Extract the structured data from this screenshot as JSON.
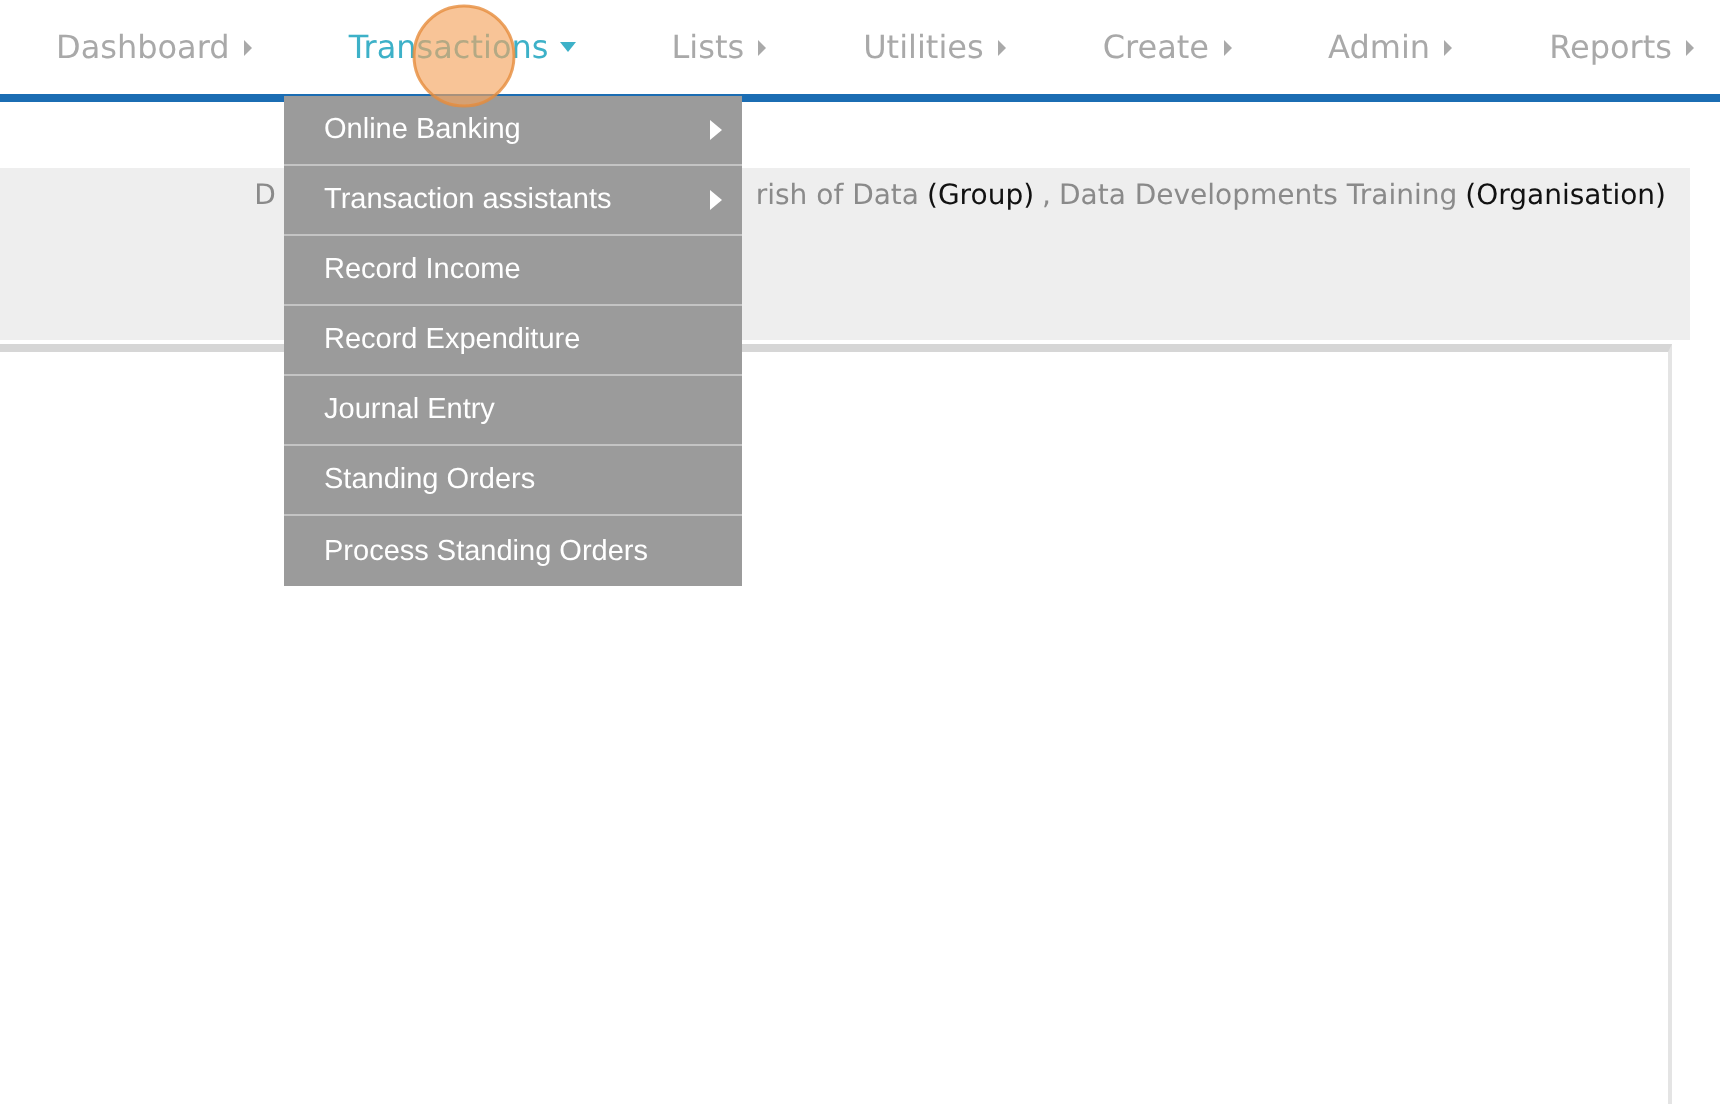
{
  "nav": [
    {
      "label": "Dashboard",
      "selected": false
    },
    {
      "label": "Transactions",
      "selected": true
    },
    {
      "label": "Lists",
      "selected": false
    },
    {
      "label": "Utilities",
      "selected": false
    },
    {
      "label": "Create",
      "selected": false
    },
    {
      "label": "Admin",
      "selected": false
    },
    {
      "label": "Reports",
      "selected": false
    }
  ],
  "breadcrumb": [
    {
      "text": "D",
      "kind": "link"
    },
    {
      "text": "rish of Data",
      "kind": "link"
    },
    {
      "text": "(Group)",
      "kind": "type"
    },
    {
      "text": ",",
      "kind": "link"
    },
    {
      "text": "Data Developments Training",
      "kind": "link"
    },
    {
      "text": "(Organisation)",
      "kind": "type"
    }
  ],
  "menu": [
    {
      "label": "Online Banking",
      "has_submenu": true
    },
    {
      "label": "Transaction assistants",
      "has_submenu": true
    },
    {
      "label": "Record Income",
      "has_submenu": false
    },
    {
      "label": "Record Expenditure",
      "has_submenu": false
    },
    {
      "label": "Journal Entry",
      "has_submenu": false
    },
    {
      "label": "Standing Orders",
      "has_submenu": false
    },
    {
      "label": "Process Standing Orders",
      "has_submenu": false
    }
  ]
}
